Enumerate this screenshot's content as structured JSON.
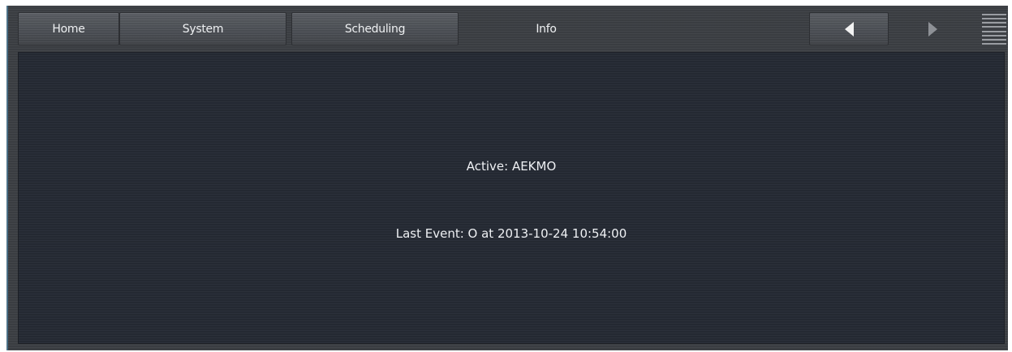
{
  "nav": {
    "tabs": [
      {
        "label": "Home"
      },
      {
        "label": "System"
      },
      {
        "label": "Scheduling"
      },
      {
        "label": "Info"
      }
    ],
    "back_icon": "triangle-left",
    "forward_icon": "triangle-right",
    "menu_icon": "hamburger-lines"
  },
  "info": {
    "active": "Active: AEKMO",
    "last_event": "Last Event: O at 2013-10-24 10:54:00"
  }
}
